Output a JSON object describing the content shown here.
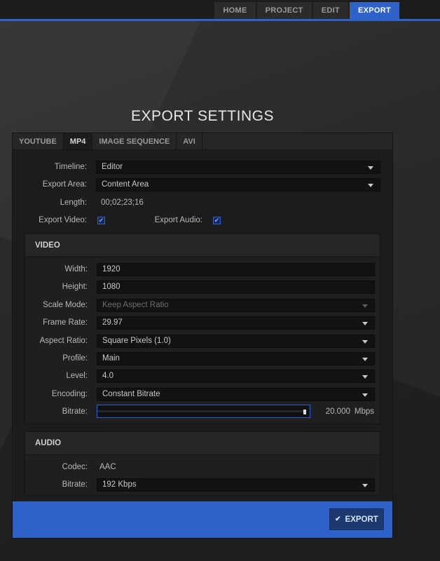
{
  "nav": {
    "tabs": [
      "HOME",
      "PROJECT",
      "EDIT",
      "EXPORT"
    ],
    "active": "EXPORT"
  },
  "title": "EXPORT SETTINGS",
  "format_tabs": [
    "YOUTUBE",
    "MP4",
    "IMAGE SEQUENCE",
    "AVI"
  ],
  "active_format": "MP4",
  "general": {
    "timeline_label": "Timeline:",
    "timeline_value": "Editor",
    "export_area_label": "Export Area:",
    "export_area_value": "Content Area",
    "length_label": "Length:",
    "length_value": "00;02;23;16",
    "export_video_label": "Export Video:",
    "export_video_checked": true,
    "export_audio_label": "Export Audio:",
    "export_audio_checked": true
  },
  "video": {
    "heading": "VIDEO",
    "width_label": "Width:",
    "width_value": "1920",
    "height_label": "Height:",
    "height_value": "1080",
    "scale_mode_label": "Scale Mode:",
    "scale_mode_value": "Keep Aspect Ratio",
    "frame_rate_label": "Frame Rate:",
    "frame_rate_value": "29.97",
    "aspect_ratio_label": "Aspect Ratio:",
    "aspect_ratio_value": "Square Pixels (1.0)",
    "profile_label": "Profile:",
    "profile_value": "Main",
    "level_label": "Level:",
    "level_value": "4.0",
    "encoding_label": "Encoding:",
    "encoding_value": "Constant Bitrate",
    "bitrate_label": "Bitrate:",
    "bitrate_value": "20.000",
    "bitrate_unit": "Mbps",
    "bitrate_fraction": 0.99
  },
  "audio": {
    "heading": "AUDIO",
    "codec_label": "Codec:",
    "codec_value": "AAC",
    "bitrate_label": "Bitrate:",
    "bitrate_value": "192 Kbps"
  },
  "footer": {
    "export_label": "EXPORT",
    "export_icon": "check-icon"
  },
  "colors": {
    "accent": "#2f62c9",
    "panel": "#1c1c1d",
    "background": "#2a2a2b"
  }
}
